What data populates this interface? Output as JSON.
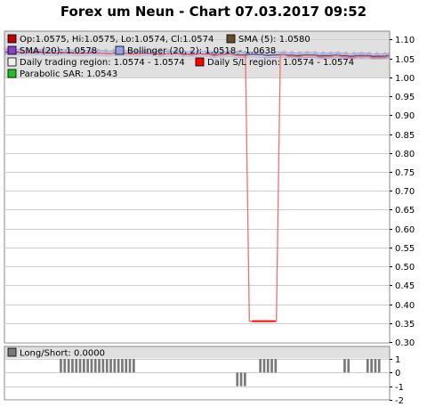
{
  "title": "Forex um Neun - Chart 07.03.2017 09:52",
  "colors": {
    "legend_bg": "#e0e0e0",
    "grid": "#cfcfcf",
    "price_line": "#ee7070",
    "sma5": "#555555",
    "sma20": "#8a40c8",
    "bollinger": "#9aa0e8",
    "trading_region": "#d6d6d6",
    "sl_region": "#ff0000",
    "parabolic_sar": "#20c020",
    "longshort": "#7a7a7a"
  },
  "legend": {
    "ohlc": "Op:1.0575, Hi:1.0575, Lo:1.0574, Cl:1.0574",
    "sma5": "SMA (5): 1.0580",
    "sma20": "SMA (20): 1.0578",
    "bollinger": "Bollinger (20, 2): 1.0518 - 1.0638",
    "trading_region": "Daily trading region: 1.0574 - 1.0574",
    "sl_region": "Daily S/L region: 1.0574 - 1.0574",
    "parabolic_sar": "Parabolic SAR: 1.0543",
    "longshort": "Long/Short: 0.0000"
  },
  "chart_data": [
    {
      "type": "line",
      "panel": "price",
      "ylim": [
        0.3,
        1.12
      ],
      "yticks": [
        1.1,
        1.05,
        1.0,
        0.95,
        0.9,
        0.85,
        0.8,
        0.75,
        0.7,
        0.65,
        0.6,
        0.55,
        0.5,
        0.45,
        0.4,
        0.35,
        0.3
      ],
      "ytick_labels": [
        "1.10",
        "1.05",
        "1.00",
        "0.95",
        "0.90",
        "0.85",
        "0.80",
        "0.75",
        "0.70",
        "0.65",
        "0.60",
        "0.55",
        "0.50",
        "0.45",
        "0.40",
        "0.35",
        "0.30"
      ],
      "grid": true,
      "legend_position": "top",
      "n_points": 100,
      "series": [
        {
          "name": "Close",
          "spikes": [
            {
              "from": 63,
              "to": 70,
              "value": 0.355
            }
          ],
          "baseline": [
            1.068,
            1.053
          ]
        },
        {
          "name": "SMA (5)",
          "baseline": [
            1.067,
            1.056
          ]
        },
        {
          "name": "SMA (20)",
          "baseline": [
            1.066,
            1.057
          ]
        },
        {
          "name": "Bollinger (20, 2)",
          "upper": [
            1.074,
            1.063
          ],
          "lower": [
            1.06,
            1.05
          ]
        },
        {
          "name": "Parabolic SAR",
          "baseline": [
            1.069,
            1.057
          ]
        }
      ]
    },
    {
      "type": "bar",
      "panel": "long_short",
      "ylim": [
        -2,
        1
      ],
      "yticks": [
        1,
        0,
        -1,
        -2
      ],
      "ytick_labels": [
        "1",
        "0",
        "-1",
        "-2"
      ],
      "values": [
        0,
        0,
        0,
        0,
        0,
        0,
        0,
        0,
        0,
        0,
        0,
        0,
        0,
        0,
        1,
        1,
        1,
        1,
        1,
        1,
        1,
        1,
        1,
        1,
        1,
        1,
        1,
        1,
        1,
        1,
        1,
        1,
        1,
        1,
        0,
        0,
        0,
        0,
        0,
        0,
        0,
        0,
        0,
        0,
        0,
        0,
        0,
        0,
        0,
        0,
        0,
        0,
        0,
        0,
        0,
        0,
        0,
        0,
        0,
        0,
        -1,
        -1,
        -1,
        0,
        0,
        0,
        1,
        1,
        1,
        1,
        1,
        0,
        0,
        0,
        0,
        0,
        0,
        0,
        0,
        0,
        0,
        0,
        0,
        0,
        0,
        0,
        0,
        0,
        1,
        1,
        0,
        0,
        0,
        0,
        1,
        1,
        1,
        1,
        0,
        0
      ]
    }
  ]
}
